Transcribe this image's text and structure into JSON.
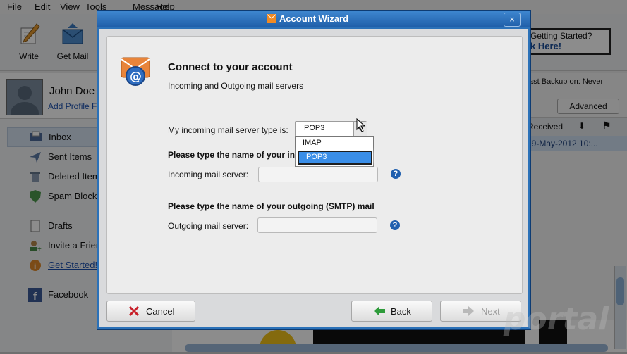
{
  "menu": [
    "File",
    "Edit",
    "View",
    "Tools",
    "Message",
    "Help"
  ],
  "toolbar": {
    "write": "Write",
    "get_mail": "Get Mail"
  },
  "getting_started_banner": {
    "line1": "Getting Started?",
    "line2": "k Here!"
  },
  "profile": {
    "name": "John Doe",
    "link": "Add Profile F"
  },
  "sidebar": {
    "items": [
      {
        "label": "Inbox",
        "icon": "inbox-icon"
      },
      {
        "label": "Sent Items",
        "icon": "sent-icon"
      },
      {
        "label": "Deleted Item",
        "icon": "trash-icon"
      },
      {
        "label": "Spam Blocke",
        "icon": "shield-icon"
      },
      {
        "label": "Drafts",
        "icon": "drafts-icon"
      },
      {
        "label": "Invite a Frien",
        "icon": "invite-icon"
      },
      {
        "label": "Get Started!",
        "icon": "info-icon"
      },
      {
        "label": "Facebook",
        "icon": "facebook-icon"
      }
    ]
  },
  "right_panel": {
    "backup": "ast Backup on:  Never",
    "advanced": "Advanced",
    "received_header": "Received",
    "received_value": "29-May-2012 10:..."
  },
  "dialog": {
    "title": "Account Wizard",
    "close": "×",
    "heading": "Connect to your account",
    "subheading": "Incoming and Outgoing mail servers",
    "server_type_label": "My incoming mail server type is:",
    "server_type_value": "POP3",
    "options": [
      "IMAP",
      "POP3"
    ],
    "incoming_prompt": "Please type the name of your inc",
    "incoming_label": "Incoming mail server:",
    "incoming_value": "",
    "outgoing_prompt": "Please type the name of your outgoing (SMTP) mail",
    "outgoing_label": "Outgoing mail server:",
    "outgoing_value": "",
    "help": "?",
    "cancel": "Cancel",
    "back": "Back",
    "next": "Next"
  },
  "colors": {
    "accent": "#2b71b8",
    "selection": "#3a8ee8",
    "cancel_icon": "#c8202a",
    "back_icon": "#2e9b3a"
  }
}
